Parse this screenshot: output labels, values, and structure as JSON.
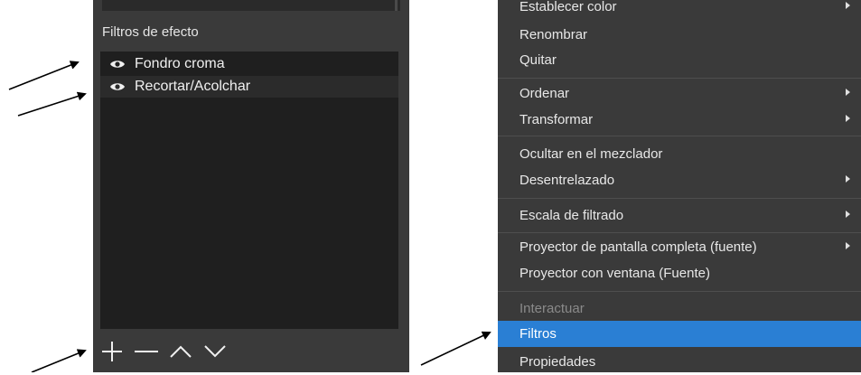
{
  "filters_panel": {
    "title": "Filtros de efecto",
    "items": [
      {
        "label": "Fondro croma",
        "icon": "eye-icon"
      },
      {
        "label": "Recortar/Acolchar",
        "icon": "eye-icon"
      }
    ],
    "toolbar": [
      "add-icon",
      "remove-icon",
      "move-up-icon",
      "move-down-icon"
    ]
  },
  "context_menu": {
    "items": [
      {
        "label": "Establecer color",
        "submenu": true
      },
      {
        "label": "Renombrar"
      },
      {
        "label": "Quitar"
      },
      {
        "label": "Ordenar",
        "submenu": true
      },
      {
        "label": "Transformar",
        "submenu": true
      },
      {
        "label": "Ocultar en el mezclador"
      },
      {
        "label": "Desentrelazado",
        "submenu": true
      },
      {
        "label": "Escala de filtrado",
        "submenu": true
      },
      {
        "label": "Proyector de pantalla completa (fuente)",
        "submenu": true
      },
      {
        "label": "Proyector con ventana (Fuente)"
      },
      {
        "label": "Interactuar",
        "disabled": true
      },
      {
        "label": "Filtros",
        "highlighted": true
      },
      {
        "label": "Propiedades"
      }
    ]
  },
  "colors": {
    "panel_bg": "#3a3a3a",
    "list_bg": "#1f1f1f",
    "highlight": "#2a7fd4",
    "annotation_arrow": "#000000"
  }
}
